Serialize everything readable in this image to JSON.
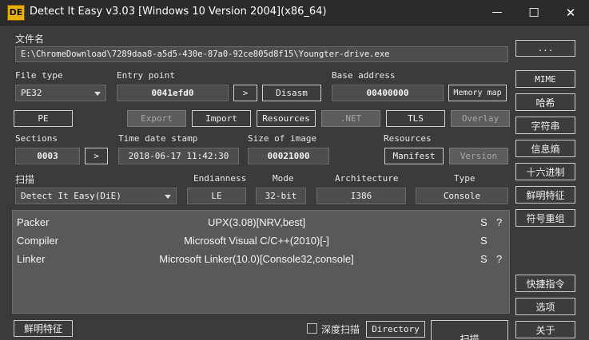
{
  "window": {
    "icon_text": "DE",
    "title": "Detect It Easy v3.03 [Windows 10 Version 2004](x86_64)",
    "minimize_glyph": "—",
    "maximize_glyph": "☐",
    "close_glyph": "✕"
  },
  "file": {
    "label": "文件名",
    "path": "E:\\ChromeDownload\\7289daa8-a5d5-430e-87a0-92ce805d8f15\\Youngter-drive.exe",
    "browse_label": "..."
  },
  "file_type": {
    "label": "File type",
    "value": "PE32"
  },
  "entry_point": {
    "label": "Entry point",
    "value": "0041efd0",
    "go_label": ">",
    "disasm_label": "Disasm"
  },
  "base_address": {
    "label": "Base address",
    "value": "00400000",
    "memory_map_label": "Memory map"
  },
  "buttons_row": {
    "pe": "PE",
    "export": "Export",
    "import": "Import",
    "resources": "Resources",
    "net": ".NET",
    "tls": "TLS",
    "overlay": "Overlay"
  },
  "sections": {
    "label": "Sections",
    "value": "0003",
    "go_label": ">"
  },
  "time_date_stamp": {
    "label": "Time date stamp",
    "value": "2018-06-17 11:42:30"
  },
  "size_of_image": {
    "label": "Size of image",
    "value": "00021000"
  },
  "resources_group": {
    "label": "Resources",
    "manifest": "Manifest",
    "version": "Version"
  },
  "scan": {
    "label": "扫描",
    "engine": "Detect It Easy(DiE)",
    "endianness_label": "Endianness",
    "endianness": "LE",
    "mode_label": "Mode",
    "mode": "32-bit",
    "architecture_label": "Architecture",
    "architecture": "I386",
    "type_label": "Type",
    "type": "Console"
  },
  "results": [
    {
      "kind": "Packer",
      "value": "UPX(3.08)[NRV,best]",
      "s": "S",
      "q": "?"
    },
    {
      "kind": "Compiler",
      "value": "Microsoft Visual C/C++(2010)[-]",
      "s": "S",
      "q": ""
    },
    {
      "kind": "Linker",
      "value": "Microsoft Linker(10.0)[Console32,console]",
      "s": "S",
      "q": "?"
    }
  ],
  "bottom": {
    "signatures": "鲜明特征",
    "deep_scan": "深度扫描",
    "directory": "Directory",
    "scan_button": "扫描"
  },
  "sidebar": {
    "more": "...",
    "mime": "MIME",
    "hash": "哈希",
    "strings": "字符串",
    "entropy": "信息熵",
    "hex": "十六进制",
    "signatures": "鲜明特征",
    "symbols": "符号重组",
    "shortcuts": "快捷指令",
    "options": "选项",
    "about": "关于"
  }
}
